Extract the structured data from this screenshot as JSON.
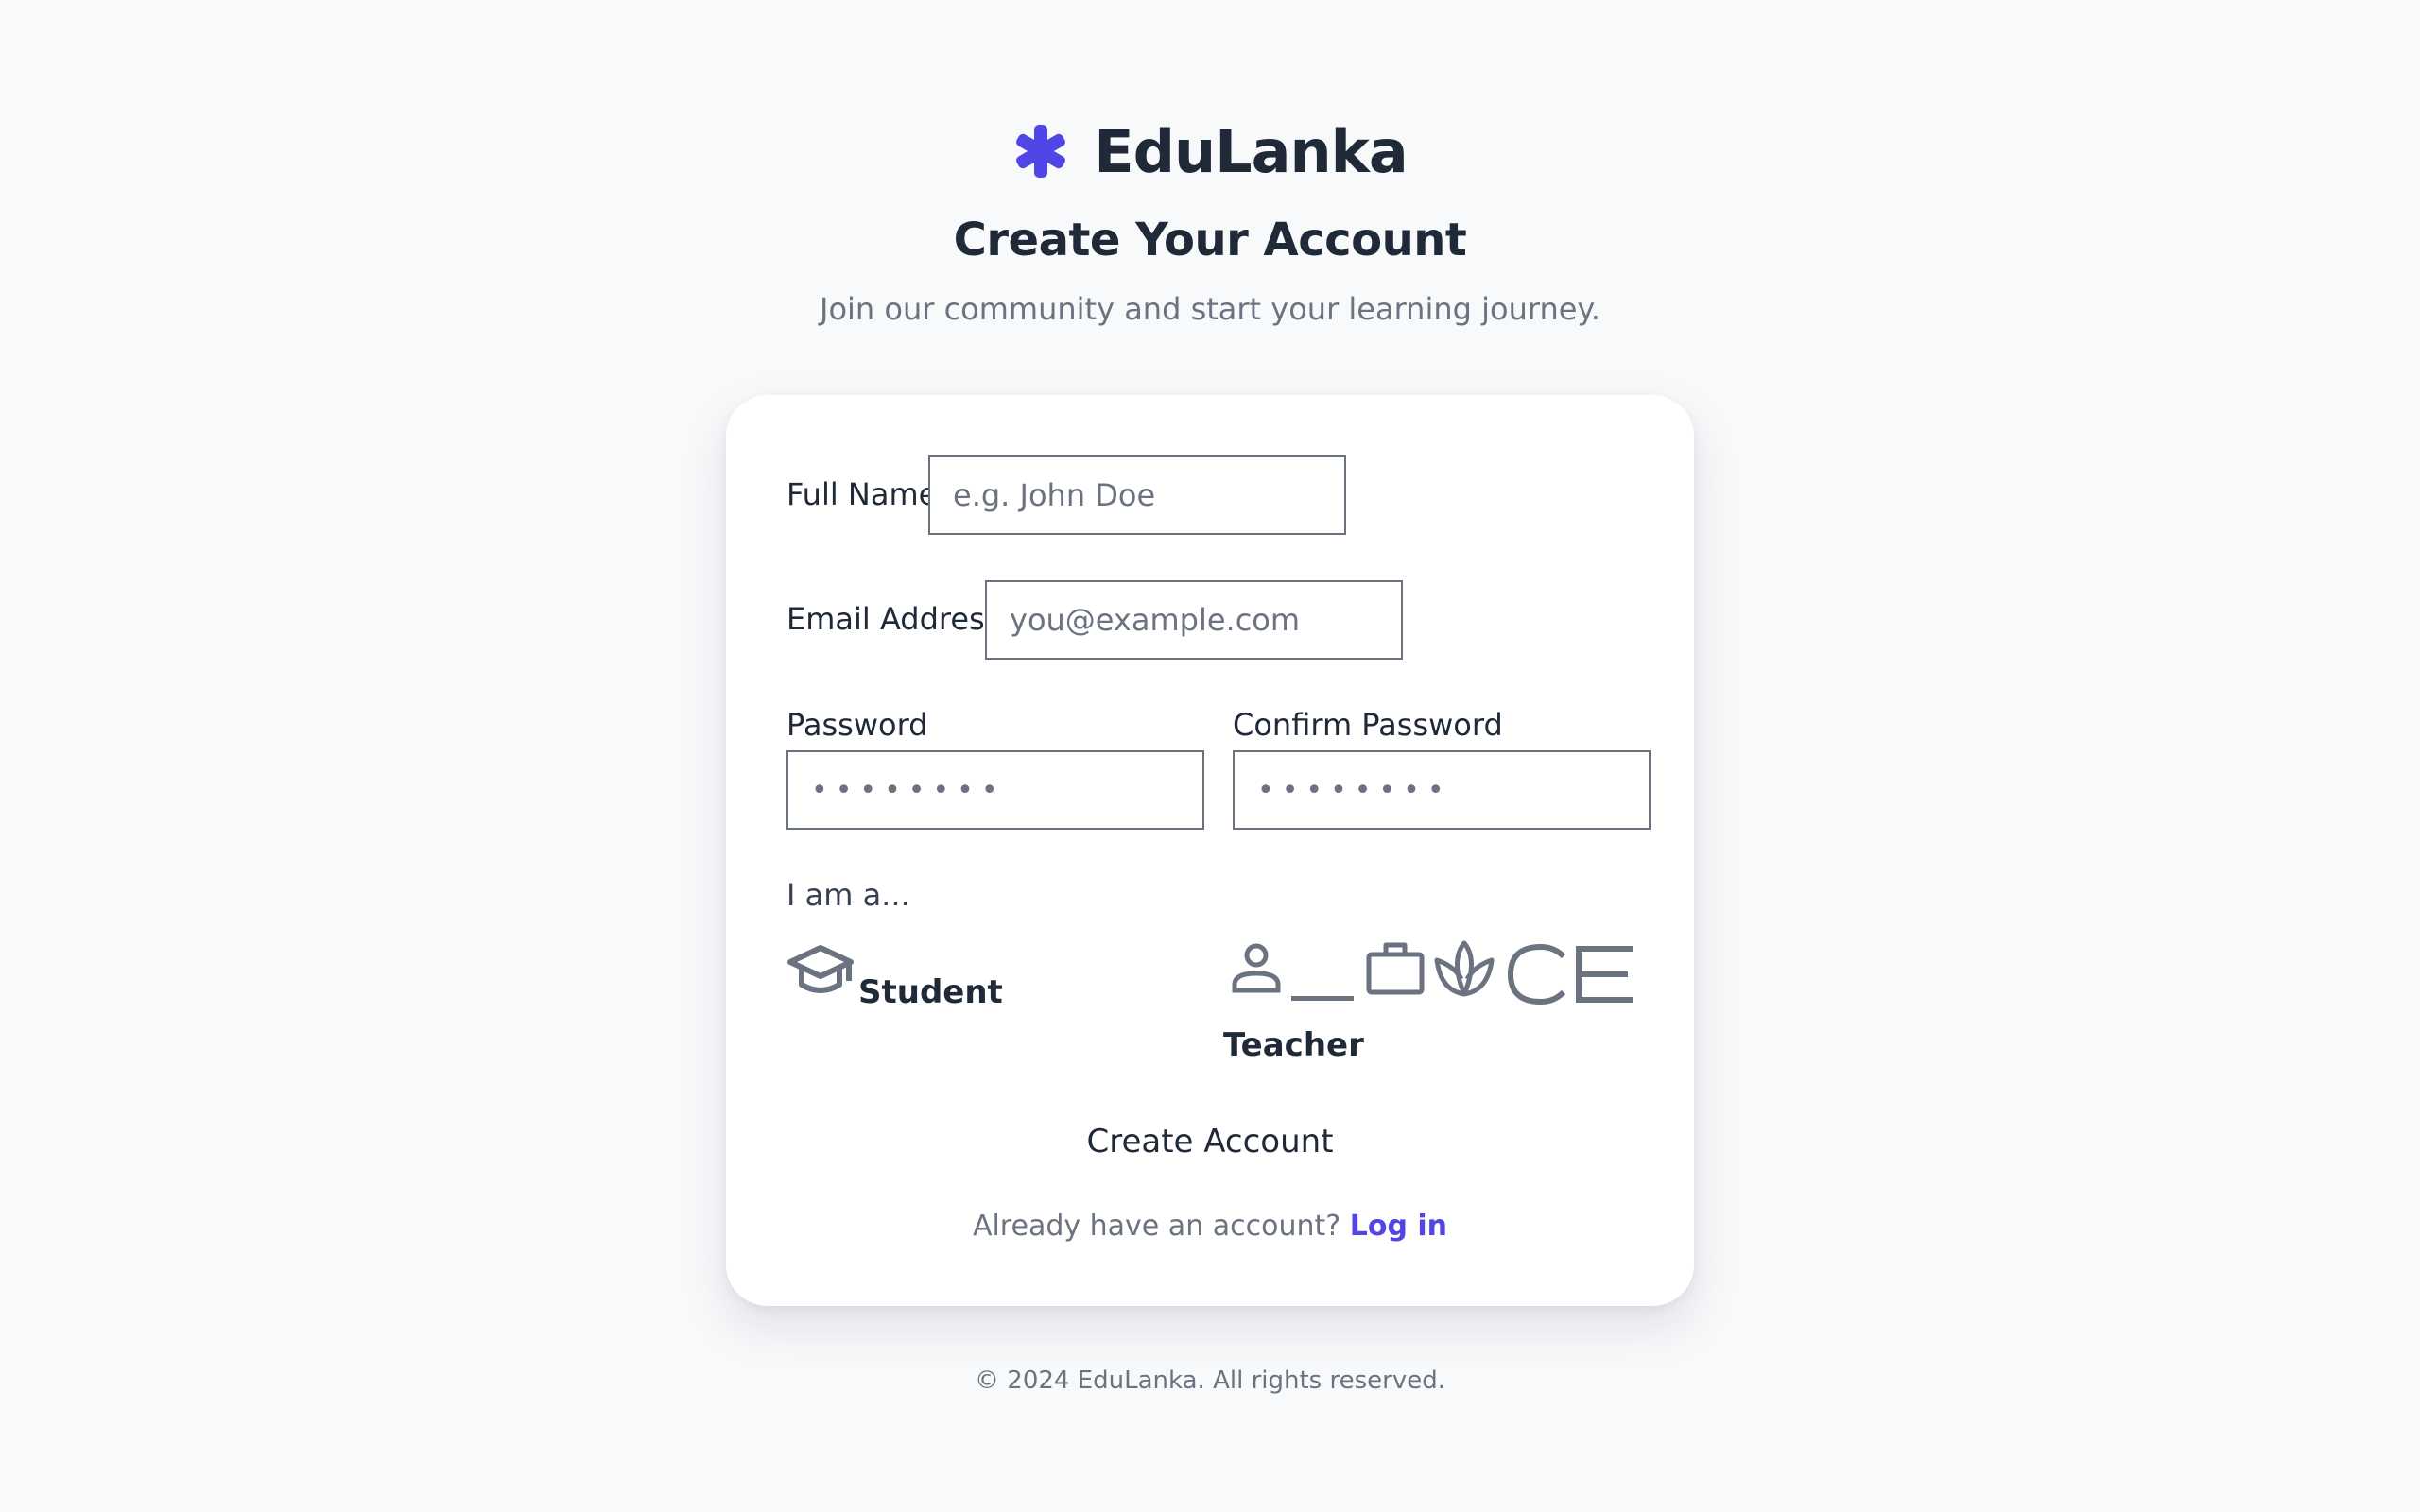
{
  "brand": {
    "name": "EduLanka",
    "icon": "asterisk-icon",
    "accent_color": "#4f46e5"
  },
  "header": {
    "title": "Create Your Account",
    "subtitle": "Join our community and start your learning journey."
  },
  "form": {
    "full_name": {
      "label": "Full Name",
      "placeholder": "e.g. John Doe",
      "value": ""
    },
    "email": {
      "label": "Email Address",
      "placeholder": "you@example.com",
      "value": ""
    },
    "password": {
      "label": "Password",
      "value": "••••••••"
    },
    "confirm_password": {
      "label": "Confirm Password",
      "value": "••••••••"
    },
    "role_prompt": "I am a...",
    "roles": [
      {
        "label": "Student",
        "icon": "graduation-cap-icon"
      },
      {
        "label": "Teacher",
        "icons": [
          "person-icon",
          "briefcase-icon",
          "lotus-icon"
        ],
        "icon_text": "CE"
      }
    ],
    "submit_label": "Create Account",
    "login_prompt": "Already have an account?",
    "login_link": "Log in"
  },
  "footer": {
    "copyright": "© 2024 EduLanka. All rights reserved."
  },
  "colors": {
    "background": "#f8f9fb",
    "text": "#1f2937",
    "muted": "#6b7280",
    "icon_gray": "#6b7280"
  }
}
